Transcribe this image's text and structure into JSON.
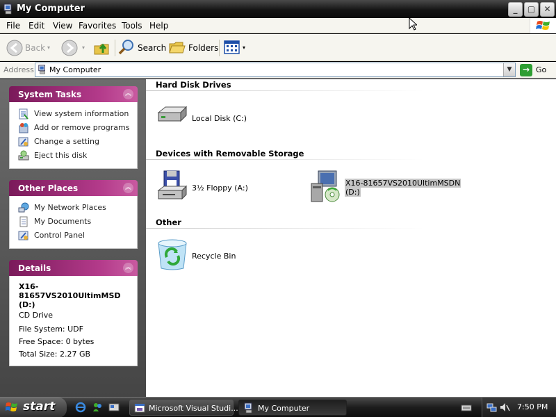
{
  "window": {
    "title": "My Computer",
    "minimize": "_",
    "maximize": "▢",
    "close": "✕"
  },
  "menu": [
    "File",
    "Edit",
    "View",
    "Favorites",
    "Tools",
    "Help"
  ],
  "toolbar": {
    "back": "Back",
    "search": "Search",
    "folders": "Folders"
  },
  "address": {
    "label": "Address",
    "value": "My Computer",
    "go": "Go"
  },
  "system_tasks": {
    "title": "System Tasks",
    "items": [
      "View system information",
      "Add or remove programs",
      "Change a setting",
      "Eject this disk"
    ]
  },
  "other_places": {
    "title": "Other Places",
    "items": [
      "My Network Places",
      "My Documents",
      "Control Panel"
    ]
  },
  "details": {
    "title": "Details",
    "name": "X16-81657VS2010UltimMSD (D:)",
    "type": "CD Drive",
    "file_system": "File System: UDF",
    "free_space": "Free Space: 0 bytes",
    "total_size": "Total Size: 2.27 GB"
  },
  "groups": {
    "hard_disk": "Hard Disk Drives",
    "removable": "Devices with Removable Storage",
    "other": "Other"
  },
  "items": {
    "local_disk": "Local Disk (C:)",
    "floppy": "3½ Floppy (A:)",
    "dvd_line1": "X16-81657VS2010UltimMSDN",
    "dvd_line2": "(D:)",
    "recycle": "Recycle Bin"
  },
  "taskbar": {
    "start": "start",
    "tasks": [
      "Microsoft Visual Studi...",
      "My Computer"
    ],
    "clock": "7:50 PM"
  }
}
